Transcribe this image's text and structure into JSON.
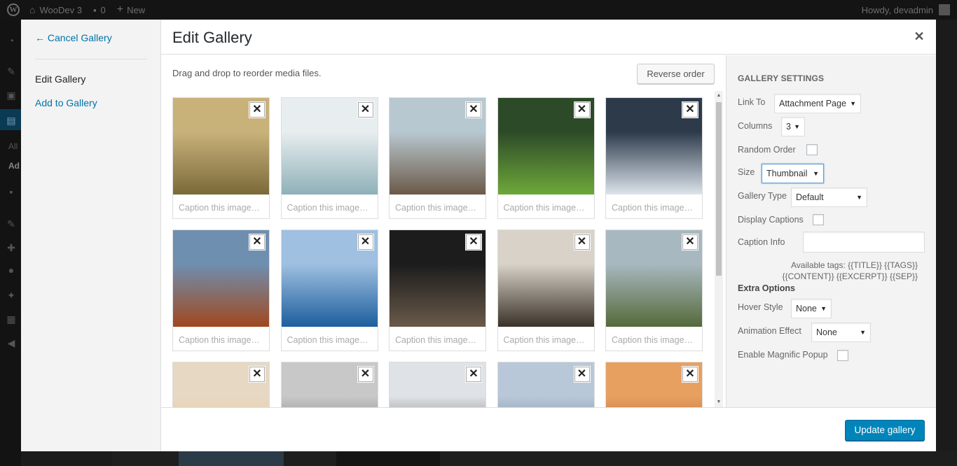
{
  "adminbar": {
    "site_name": "WooDev 3",
    "comments_count": "0",
    "new_label": "New",
    "howdy": "Howdy, devadmin"
  },
  "adminmenu": {
    "all_text": "All",
    "ad_text": "Ad"
  },
  "menu": {
    "cancel_label": "← Cancel Gallery",
    "edit_label": "Edit Gallery",
    "add_label": "Add to Gallery"
  },
  "modal": {
    "title": "Edit Gallery",
    "hint": "Drag and drop to reorder media files.",
    "reverse_label": "Reverse order",
    "update_label": "Update gallery"
  },
  "caption_placeholder": "Caption this image…",
  "tiles": [
    {
      "row": 0,
      "col": 0,
      "icon": "truck-photo",
      "colors": [
        "#c9b27a",
        "#7a6a3a"
      ]
    },
    {
      "row": 0,
      "col": 1,
      "icon": "car-photo",
      "colors": [
        "#e8eef0",
        "#8fb0b8"
      ]
    },
    {
      "row": 0,
      "col": 2,
      "icon": "beach-photo",
      "colors": [
        "#b8c8d0",
        "#6b5a48"
      ]
    },
    {
      "row": 0,
      "col": 3,
      "icon": "waterfall-photo",
      "colors": [
        "#2d4a28",
        "#6ea83a"
      ]
    },
    {
      "row": 0,
      "col": 4,
      "icon": "snow-cabin-photo",
      "colors": [
        "#2c3a4a",
        "#dde4ec"
      ]
    },
    {
      "row": 1,
      "col": 0,
      "icon": "canyon-photo",
      "colors": [
        "#6f8fb0",
        "#a0481e"
      ]
    },
    {
      "row": 1,
      "col": 1,
      "icon": "fjord-photo",
      "colors": [
        "#9fc0e0",
        "#1d5e9e"
      ]
    },
    {
      "row": 1,
      "col": 2,
      "icon": "coffee-photo",
      "colors": [
        "#1c1c1c",
        "#6a5a4a"
      ]
    },
    {
      "row": 1,
      "col": 3,
      "icon": "sunset-cliff-photo",
      "colors": [
        "#d8d2c8",
        "#3a3228"
      ]
    },
    {
      "row": 1,
      "col": 4,
      "icon": "coast-photo",
      "colors": [
        "#a8b8c0",
        "#556a3a"
      ]
    },
    {
      "row": 2,
      "col": 0,
      "icon": "sky-photo",
      "colors": [
        "#e6d8c2",
        "#f2c890"
      ]
    },
    {
      "row": 2,
      "col": 1,
      "icon": "building-photo",
      "colors": [
        "#c8c8c8",
        "#555555"
      ]
    },
    {
      "row": 2,
      "col": 2,
      "icon": "hill-photo",
      "colors": [
        "#dfe2e6",
        "#3a3a3a"
      ]
    },
    {
      "row": 2,
      "col": 3,
      "icon": "lake-photo",
      "colors": [
        "#b8c8d8",
        "#556a80"
      ]
    },
    {
      "row": 2,
      "col": 4,
      "icon": "sunrise-photo",
      "colors": [
        "#e8a060",
        "#a05030"
      ]
    }
  ],
  "settings": {
    "heading": "Gallery Settings",
    "link_to_label": "Link To",
    "link_to_value": "Attachment Page",
    "columns_label": "Columns",
    "columns_value": "3",
    "random_order_label": "Random Order",
    "size_label": "Size",
    "size_value": "Thumbnail",
    "gallery_type_label": "Gallery Type",
    "gallery_type_value": "Default",
    "display_captions_label": "Display Captions",
    "caption_info_label": "Caption Info",
    "available_tags": "Available tags: {{TITLE}} {{TAGS}} {{CONTENT}} {{EXCERPT}} {{SEP}}",
    "extra_options": "Extra Options",
    "hover_style_label": "Hover Style",
    "hover_style_value": "None",
    "animation_effect_label": "Animation Effect",
    "animation_effect_value": "None",
    "magnific_popup_label": "Enable Magnific Popup"
  },
  "colors": {
    "primary_button": "#0085ba",
    "link": "#0073aa",
    "admin_bar": "#141414"
  }
}
